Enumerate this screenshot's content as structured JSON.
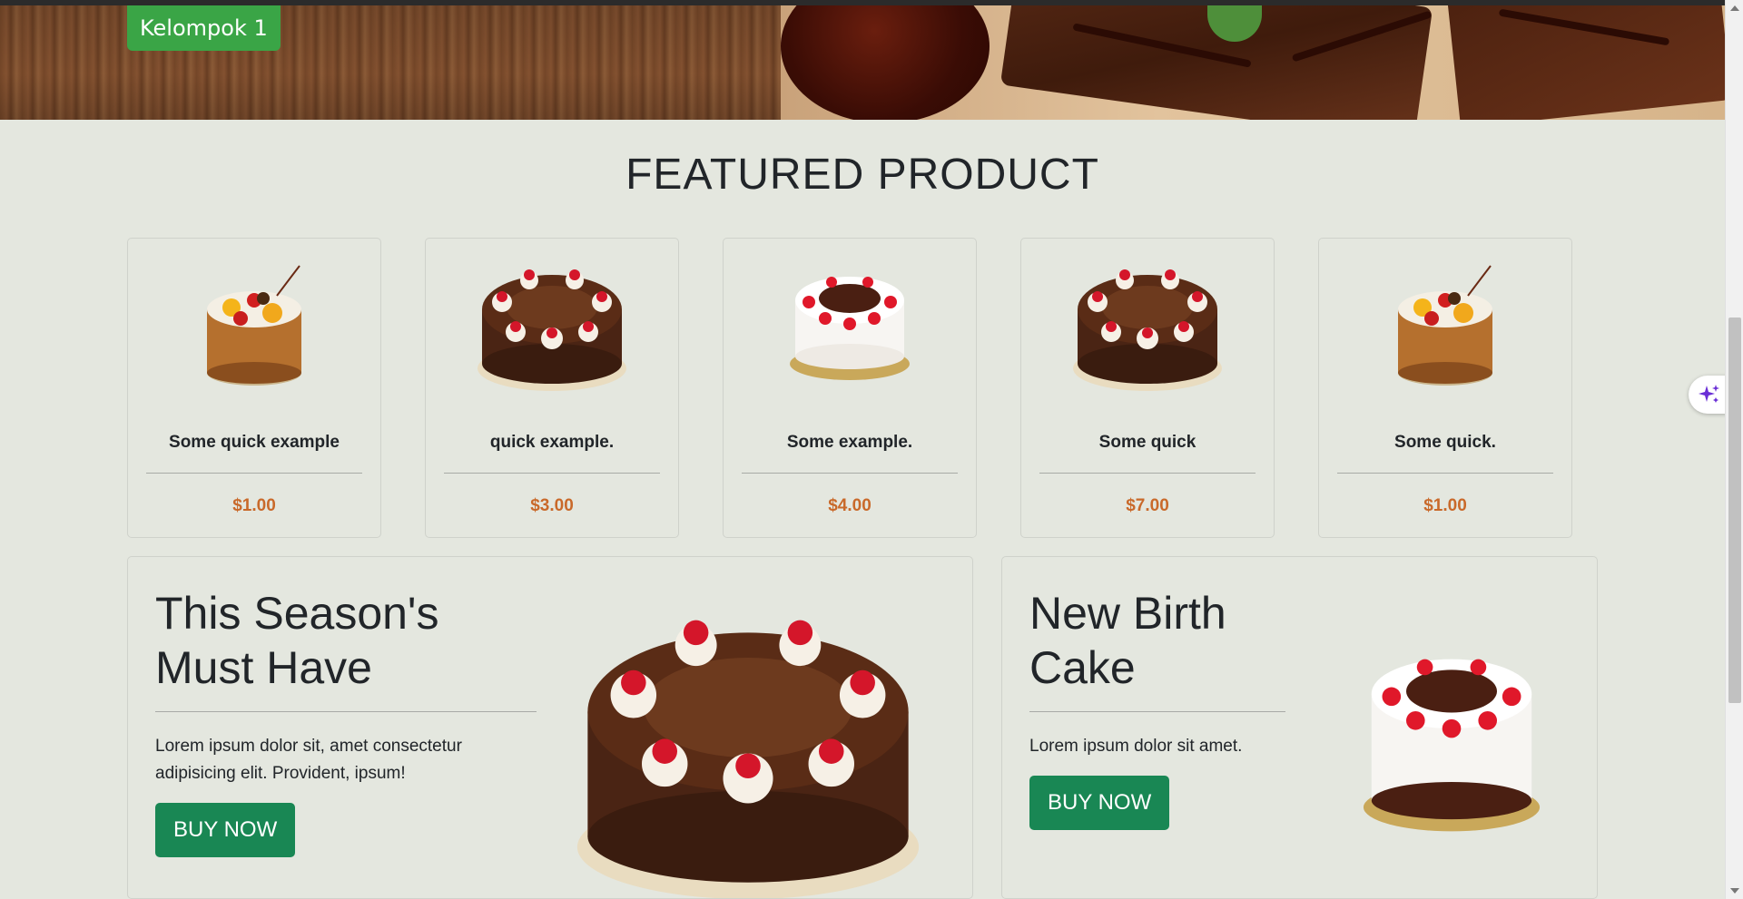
{
  "brand": {
    "label": "Kelompok 1"
  },
  "featured": {
    "title": "FEATURED PRODUCT",
    "products": [
      {
        "name": "Some quick example",
        "price": "$1.00",
        "image": "fruit-cake-icon"
      },
      {
        "name": "quick example.",
        "price": "$3.00",
        "image": "chocolate-cake-icon"
      },
      {
        "name": "Some example.",
        "price": "$4.00",
        "image": "black-forest-cake-icon"
      },
      {
        "name": "Some quick",
        "price": "$7.00",
        "image": "chocolate-cake-icon"
      },
      {
        "name": "Some quick.",
        "price": "$1.00",
        "image": "fruit-cake-icon"
      }
    ]
  },
  "promos": [
    {
      "title_line1": "This Season's",
      "title_line2": "Must Have",
      "text_line1": "Lorem ipsum dolor sit, amet consectetur",
      "text_line2": "adipisicing elit. Provident, ipsum!",
      "button": "BUY NOW"
    },
    {
      "title_line1": "New Birth",
      "title_line2": "Cake",
      "text_line1": "Lorem ipsum dolor sit amet.",
      "button": "BUY NOW"
    }
  ],
  "colors": {
    "page_bg": "#e4e7df",
    "brand_green": "#3aa546",
    "button_green": "#198754",
    "price_orange": "#c9692a"
  }
}
